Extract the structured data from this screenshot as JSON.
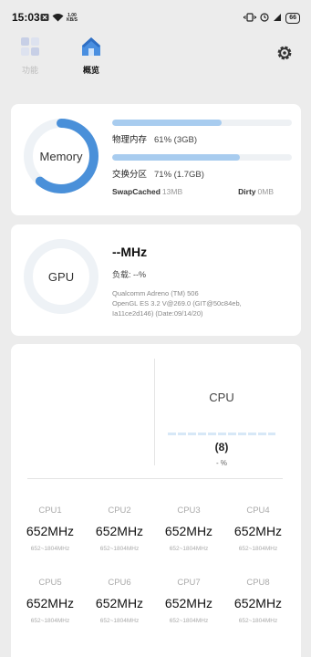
{
  "status_bar": {
    "time": "15:03",
    "net_speed_value": "1.00",
    "net_speed_unit": "KB/S",
    "battery": "66"
  },
  "nav": {
    "tab_functions": "功能",
    "tab_overview": "概览"
  },
  "memory": {
    "ring_label": "Memory",
    "ring_fraction": 0.61,
    "physical": {
      "label": "物理内存",
      "value": "61% (3GB)",
      "fraction": 0.61
    },
    "swap": {
      "label": "交换分区",
      "value": "71% (1.7GB)",
      "fraction": 0.71
    },
    "swap_cached": {
      "label": "SwapCached",
      "value": "13MB"
    },
    "dirty": {
      "label": "Dirty",
      "value": "0MB"
    }
  },
  "gpu": {
    "ring_label": "GPU",
    "freq": "--MHz",
    "load": "负载: --%",
    "renderer": "Qualcomm Adreno (TM) 506",
    "gl_version": "OpenGL ES 3.2 V@269.0 (GIT@50c84eb,",
    "gl_build": "Ia11ce2d146) (Date:09/14/20)"
  },
  "cpu": {
    "title": "CPU",
    "cores_count": "(8)",
    "load": "- %",
    "cores": [
      {
        "name": "CPU1",
        "freq": "652MHz",
        "range": "652~1804MHz"
      },
      {
        "name": "CPU2",
        "freq": "652MHz",
        "range": "652~1804MHz"
      },
      {
        "name": "CPU3",
        "freq": "652MHz",
        "range": "652~1804MHz"
      },
      {
        "name": "CPU4",
        "freq": "652MHz",
        "range": "652~1804MHz"
      },
      {
        "name": "CPU5",
        "freq": "652MHz",
        "range": "652~1804MHz"
      },
      {
        "name": "CPU6",
        "freq": "652MHz",
        "range": "652~1804MHz"
      },
      {
        "name": "CPU7",
        "freq": "652MHz",
        "range": "652~1804MHz"
      },
      {
        "name": "CPU8",
        "freq": "652MHz",
        "range": "652~1804MHz"
      }
    ]
  },
  "colors": {
    "accent": "#4a90d9",
    "bar_fill": "#a8ccef",
    "ring_track": "#eef2f6"
  }
}
